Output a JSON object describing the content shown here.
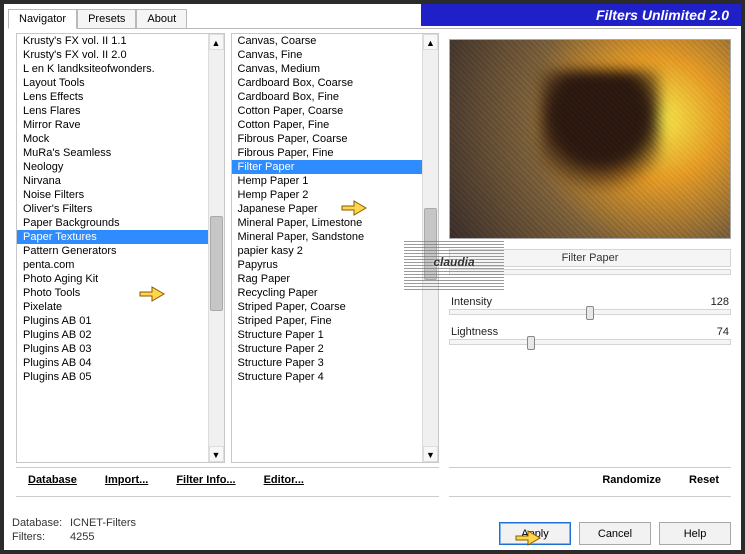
{
  "banner": {
    "title": "Filters Unlimited 2.0"
  },
  "tabs": {
    "t0": "Navigator",
    "t1": "Presets",
    "t2": "About"
  },
  "categories": [
    "Krusty's FX vol. II 1.1",
    "Krusty's FX vol. II 2.0",
    "L en K landksiteofwonders.",
    "Layout Tools",
    "Lens Effects",
    "Lens Flares",
    "Mirror Rave",
    "Mock",
    "MuRa's Seamless",
    "Neology",
    "Nirvana",
    "Noise Filters",
    "Oliver's Filters",
    "Paper Backgrounds",
    "Paper Textures",
    "Pattern Generators",
    "penta.com",
    "Photo Aging Kit",
    "Photo Tools",
    "Pixelate",
    "Plugins AB 01",
    "Plugins AB 02",
    "Plugins AB 03",
    "Plugins AB 04",
    "Plugins AB 05"
  ],
  "category_selected_index": 14,
  "filters": [
    "Canvas, Coarse",
    "Canvas, Fine",
    "Canvas, Medium",
    "Cardboard Box, Coarse",
    "Cardboard Box, Fine",
    "Cotton Paper, Coarse",
    "Cotton Paper, Fine",
    "Fibrous Paper, Coarse",
    "Fibrous Paper, Fine",
    "Filter Paper",
    "Hemp Paper 1",
    "Hemp Paper 2",
    "Japanese Paper",
    "Mineral Paper, Limestone",
    "Mineral Paper, Sandstone",
    "papier kasy 2",
    "Papyrus",
    "Rag Paper",
    "Recycling Paper",
    "Striped Paper, Coarse",
    "Striped Paper, Fine",
    "Structure Paper 1",
    "Structure Paper 2",
    "Structure Paper 3",
    "Structure Paper 4"
  ],
  "filter_selected_index": 9,
  "current_filter_name": "Filter Paper",
  "params": {
    "p0": {
      "label": "Intensity",
      "value": "128",
      "pos_pct": 50
    },
    "p1": {
      "label": "Lightness",
      "value": "74",
      "pos_pct": 29
    }
  },
  "toolbar": {
    "database": "Database",
    "import": "Import...",
    "filter_info": "Filter Info...",
    "editor": "Editor...",
    "randomize": "Randomize",
    "reset": "Reset"
  },
  "status": {
    "db_label": "Database:",
    "db_value": "ICNET-Filters",
    "filters_label": "Filters:",
    "filters_value": "4255"
  },
  "buttons": {
    "apply": "Apply",
    "cancel": "Cancel",
    "help": "Help"
  },
  "watermark": "claudia",
  "scroll": {
    "cat_thumb_top_pct": 42,
    "cat_thumb_h_pct": 24,
    "flt_thumb_top_pct": 40,
    "flt_thumb_h_pct": 18
  }
}
